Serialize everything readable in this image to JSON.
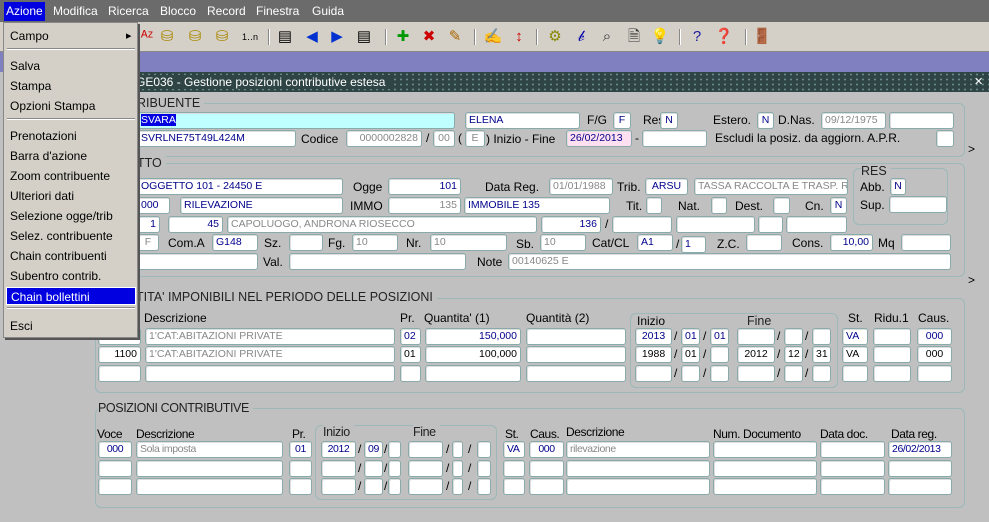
{
  "menubar": {
    "items": [
      "Azione",
      "Modifica",
      "Ricerca",
      "Blocco",
      "Record",
      "Finestra",
      "Guida"
    ]
  },
  "menu": {
    "items": [
      "Campo",
      "Salva",
      "Stampa",
      "Opzioni Stampa",
      "Prenotazioni",
      "Barra d'azione",
      "Zoom contribuente",
      "Ulteriori dati",
      "Selezione ogge/trib",
      "Selez. contribuente",
      "Chain contribuenti",
      "Subentro contrib.",
      "Chain bollettini",
      "Esci"
    ],
    "highlighted": "Chain bollettini"
  },
  "toolbar": {
    "icons": [
      "sort-az-icon",
      "db-up-icon",
      "db-down-icon",
      "db-delete-icon",
      "one-to-n-icon",
      "record-prev-block-icon",
      "arrow-left-icon",
      "arrow-right-icon",
      "record-next-block-icon",
      "add-record-icon",
      "delete-record-icon",
      "clear-icon",
      "edit-icon",
      "sort-icon",
      "query-icon",
      "variable-icon",
      "zoom-query-icon",
      "new-doc-icon",
      "bulb-icon",
      "help-icon",
      "help-context-icon",
      "exit-door-icon"
    ]
  },
  "window": {
    "title": "GE036 - Gestione posizioni contributive estesa",
    "close": "×"
  },
  "contribuente": {
    "section": "RIBUENTE",
    "cognome": "SVARA",
    "nome": "ELENA",
    "fg_label": "F/G",
    "fg": "F",
    "resid_label": "Resid.",
    "resid": "N",
    "estero_label": "Estero.",
    "estero": "N",
    "dnas_label": "D.Nas.",
    "dnas": "09/12/1975",
    "extra": "",
    "cf": "SVRLNE75T49L424M",
    "codice_label": "Codice",
    "codice": "0000002828",
    "slash": "/",
    "codice2": "00",
    "paren_open": "(",
    "tipo": "E",
    "inizio_fine_label": ") Inizio - Fine",
    "inizio": "26/02/2013",
    "dash": "-",
    "fine": "",
    "escludi_label": "Escludi la posiz. da aggiorn. A.P.R.",
    "escludi": "",
    "more": ">"
  },
  "oggetto": {
    "section": "TTO",
    "descr": "OGGETTO 101 - 24450 E",
    "ogge_label": "Ogge",
    "ogge": "101",
    "datareg_label": "Data Reg.",
    "datareg": "01/01/1988",
    "trib_label": "Trib.",
    "trib": "ARSU",
    "trib_descr": "TASSA RACCOLTA E TRASP. R",
    "res_label": "RES",
    "abb_label": "Abb.",
    "abb": "N",
    "sup_label": "Sup.",
    "sup": "",
    "cod": "000",
    "cod_descr": "RILEVAZIONE",
    "immo_label": "IMMO",
    "immo": "135",
    "immo_descr": "IMMOBILE 135",
    "tit_label": "Tit.",
    "nat_label": "Nat.",
    "dest_label": "Dest.",
    "cn_label": "Cn.",
    "cn": "N",
    "n1": "1",
    "civico": "45",
    "indirizzo": "CAPOLUOGO, ANDRONA RIOSECCO",
    "num": "136",
    "slash": "/",
    "f": "F",
    "coma_label": "Com.A",
    "coma": "G148",
    "sz_label": "Sz.",
    "fg_label": "Fg.",
    "fg": "10",
    "nr_label": "Nr.",
    "nr": "10",
    "sb_label": "Sb.",
    "sb": "10",
    "catcl_label": "Cat/CL",
    "cat": "A1",
    "cl": "1",
    "zc_label": "Z.C.",
    "cons_label": "Cons.",
    "cons": "10,00",
    "mq_label": "Mq",
    "val_label": "Val.",
    "note_label": "Note",
    "note": "00140625 E",
    "more": ">"
  },
  "quantita": {
    "section": "TITA' IMPONIBILI NEL PERIODO DELLE POSIZIONI",
    "headers": {
      "descr": "Descrizione",
      "pr": "Pr.",
      "q1": "Quantita' (1)",
      "q2": "Quantità (2)",
      "inizio": "Inizio",
      "fine": "Fine",
      "st": "St.",
      "ridu": "Ridu.1",
      "caus": "Caus."
    },
    "rows": [
      {
        "voce": "1100",
        "descr": "1'CAT:ABITAZIONI PRIVATE",
        "pr": "02",
        "q1": "150,000",
        "q2": "",
        "iy": "2013",
        "im": "01",
        "id": "01",
        "fy": "",
        "fm": "",
        "fd": "",
        "st": "VA",
        "ridu": "",
        "caus": "000"
      },
      {
        "voce": "1100",
        "descr": "1'CAT:ABITAZIONI PRIVATE",
        "pr": "01",
        "q1": "100,000",
        "q2": "",
        "iy": "1988",
        "im": "01",
        "id": "",
        "fy": "2012",
        "fm": "12",
        "fd": "31",
        "st": "VA",
        "ridu": "",
        "caus": "000"
      },
      {
        "voce": "",
        "descr": "",
        "pr": "",
        "q1": "",
        "q2": "",
        "iy": "",
        "im": "",
        "id": "",
        "fy": "",
        "fm": "",
        "fd": "",
        "st": "",
        "ridu": "",
        "caus": ""
      }
    ]
  },
  "posizioni": {
    "section": "POSIZIONI CONTRIBUTIVE",
    "headers": {
      "voce": "Voce",
      "descr": "Descrizione",
      "pr": "Pr.",
      "inizio": "Inizio",
      "fine": "Fine",
      "st": "St.",
      "caus": "Caus.",
      "descr2": "Descrizione",
      "num": "Num. Documento",
      "datadoc": "Data doc.",
      "datareg": "Data reg."
    },
    "rows": [
      {
        "voce": "000",
        "descr": "Sola imposta",
        "pr": "01",
        "iy": "2012",
        "im": "09",
        "id": "",
        "fy": "",
        "fm": "",
        "fd": "",
        "st": "VA",
        "caus": "000",
        "descr2": "rilevazione",
        "num": "",
        "datadoc": "",
        "datareg": "26/02/2013"
      },
      {
        "voce": "",
        "descr": "",
        "pr": "",
        "iy": "",
        "im": "",
        "id": "",
        "fy": "",
        "fm": "",
        "fd": "",
        "st": "",
        "caus": "",
        "descr2": "",
        "num": "",
        "datadoc": "",
        "datareg": ""
      },
      {
        "voce": "",
        "descr": "",
        "pr": "",
        "iy": "",
        "im": "",
        "id": "",
        "fy": "",
        "fm": "",
        "fd": "",
        "st": "",
        "caus": "",
        "descr2": "",
        "num": "",
        "datadoc": "",
        "datareg": ""
      }
    ]
  },
  "colors": {
    "menubar": "#6b6b6b",
    "highlight": "#0000e0",
    "band": "#8080c0",
    "titlebar": "#2f4545",
    "form": "#c0c0c0",
    "field_text": "#00008b",
    "current_field": "#c0ffff",
    "date_field": "#ffe0f0"
  }
}
